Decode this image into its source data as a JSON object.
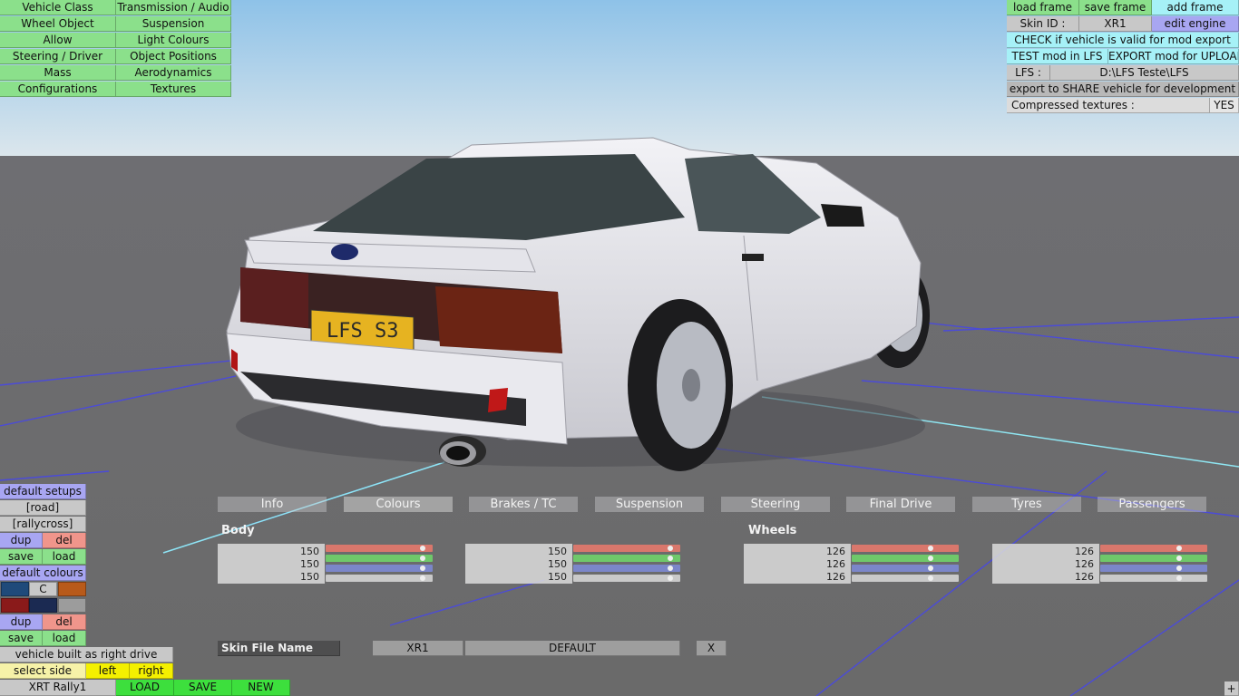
{
  "top_left_menu": [
    [
      "Vehicle Class",
      "Transmission / Audio"
    ],
    [
      "Wheel Object",
      "Suspension"
    ],
    [
      "Allow",
      "Light Colours"
    ],
    [
      "Steering / Driver",
      "Object Positions"
    ],
    [
      "Mass",
      "Aerodynamics"
    ],
    [
      "Configurations",
      "Textures"
    ]
  ],
  "top_right": {
    "load_frame": "load frame",
    "save_frame": "save frame",
    "add_frame": "add frame",
    "skin_id_label": "Skin ID :",
    "skin_id_value": "XR1",
    "edit_engine": "edit engine",
    "check_valid": "CHECK if vehicle is valid for mod export",
    "test_mod": "TEST mod in LFS",
    "export_mod": "EXPORT mod for UPLOAD",
    "lfs_label": "LFS :",
    "lfs_path": "D:\\LFS Teste\\LFS",
    "export_share": "export to SHARE vehicle for development",
    "compressed_label": "Compressed textures :",
    "compressed_value": "YES"
  },
  "scene": {
    "plate": "LFS S3"
  },
  "tabs": [
    "Info",
    "Colours",
    "Brakes / TC",
    "Suspension",
    "Steering",
    "Final Drive",
    "Tyres",
    "Passengers"
  ],
  "active_tab": "Colours",
  "sections": {
    "body": "Body",
    "wheels": "Wheels"
  },
  "colour_groups": [
    {
      "r": "150",
      "g": "150",
      "b": "150",
      "rf": 0.93,
      "gf": 0.93,
      "bf": 0.93,
      "af": 0.93
    },
    {
      "r": "150",
      "g": "150",
      "b": "150",
      "rf": 0.93,
      "gf": 0.93,
      "bf": 0.93,
      "af": 0.93
    },
    {
      "r": "126",
      "g": "126",
      "b": "126",
      "rf": 0.75,
      "gf": 0.75,
      "bf": 0.75,
      "af": 0.75
    },
    {
      "r": "126",
      "g": "126",
      "b": "126",
      "rf": 0.75,
      "gf": 0.75,
      "bf": 0.75,
      "af": 0.75
    }
  ],
  "skin_row": {
    "label": "Skin File Name",
    "skin": "XR1",
    "file": "DEFAULT",
    "close": "X"
  },
  "left_panel": {
    "default_setups": "default setups",
    "road": "[road]",
    "rallycross": "[rallycross]",
    "dup": "dup",
    "del": "del",
    "save": "save",
    "load": "load",
    "default_colours": "default colours",
    "c_label": "C",
    "right_drive": "vehicle built as right drive",
    "select_side": "select side",
    "left": "left",
    "right": "right"
  },
  "bottom_bar": {
    "vehicle_name": "XRT Rally1",
    "load": "LOAD",
    "save": "SAVE",
    "new": "NEW"
  },
  "corner_plus": "+",
  "colors": {
    "swatch_blue": "#1f4a7a",
    "swatch_orange": "#b85a1a",
    "swatch_red": "#8a1a1a",
    "swatch_navy": "#1b2a52",
    "swatch_grey": "#9c9c9c"
  }
}
